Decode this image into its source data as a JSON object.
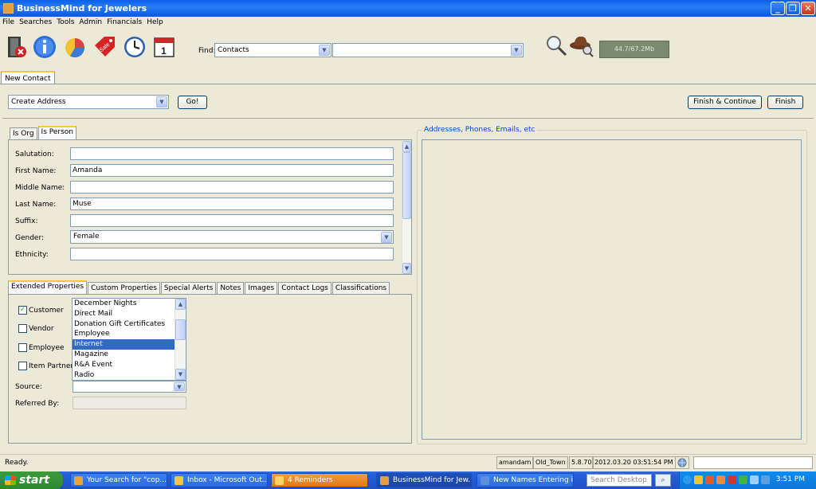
{
  "window": {
    "title": "BusinessMind for Jewelers",
    "min": "_",
    "max": "❐",
    "close": "✕"
  },
  "menu": [
    "File",
    "Searches",
    "Tools",
    "Admin",
    "Financials",
    "Help"
  ],
  "toolbar": {
    "find_label": "Find:",
    "find_category": "Contacts",
    "find_value": "",
    "memory": "44.7/67.2Mb",
    "icons": [
      "exit-icon",
      "info-icon",
      "pie-chart-icon",
      "sale-tag-icon",
      "clock-icon",
      "calendar-icon",
      "magnifier-icon",
      "detective-icon"
    ],
    "calendar_day": "1"
  },
  "doc_tab": "New Contact",
  "action": {
    "select": "Create Address",
    "go": "Go!",
    "finish_continue": "Finish & Continue",
    "finish": "Finish"
  },
  "type_tabs": [
    {
      "label": "Is Org",
      "active": false
    },
    {
      "label": "Is Person",
      "active": true
    }
  ],
  "person": {
    "fields": [
      {
        "label": "Salutation:",
        "value": ""
      },
      {
        "label": "First Name:",
        "value": "Amanda"
      },
      {
        "label": "Middle Name:",
        "value": ""
      },
      {
        "label": "Last Name:",
        "value": "Muse"
      },
      {
        "label": "Suffix:",
        "value": ""
      },
      {
        "label": "Gender:",
        "value": "Female"
      },
      {
        "label": "Ethnicity:",
        "value": ""
      }
    ]
  },
  "prop_tabs": [
    {
      "label": "Extended Properties",
      "active": true
    },
    {
      "label": "Custom Properties",
      "active": false
    },
    {
      "label": "Special Alerts",
      "active": false
    },
    {
      "label": "Notes",
      "active": false
    },
    {
      "label": "Images",
      "active": false
    },
    {
      "label": "Contact Logs",
      "active": false
    },
    {
      "label": "Classifications",
      "active": false
    }
  ],
  "extended": {
    "checks": [
      {
        "label": "Customer",
        "checked": true
      },
      {
        "label": "Vendor",
        "checked": false
      },
      {
        "label": "Employee",
        "checked": false
      },
      {
        "label": "Item Partner",
        "checked": false
      }
    ],
    "source_list": [
      "December Nights",
      "Direct Mail",
      "Donation Gift Certificates",
      "Employee",
      "Internet",
      "Magazine",
      "R&A Event",
      "Radio"
    ],
    "source_selected": "Internet",
    "source_label": "Source:",
    "source_value": "",
    "referred_label": "Referred By:",
    "referred_value": ""
  },
  "right_group": {
    "legend": "Addresses, Phones, Emails, etc"
  },
  "status": {
    "text": "Ready.",
    "user": "amandam",
    "store": "Old_Town",
    "version": "5.8.70",
    "datetime": "2012.03.20 03:51:54 PM"
  },
  "taskbar": {
    "start": "start",
    "tasks": [
      {
        "label": "Your Search for \"cop...",
        "state": "normal",
        "color": "#e9a33a"
      },
      {
        "label": "Inbox - Microsoft Out...",
        "state": "normal",
        "color": "#f7c545"
      },
      {
        "label": "4 Reminders",
        "state": "alert",
        "color": "#ffd266"
      },
      {
        "label": "BusinessMind for Jew...",
        "state": "active",
        "color": "#e0a040"
      },
      {
        "label": "New Names Entering i...",
        "state": "normal",
        "color": "#5b8fd9"
      }
    ],
    "search_placeholder": "Search Desktop",
    "clock": "3:51 PM"
  }
}
